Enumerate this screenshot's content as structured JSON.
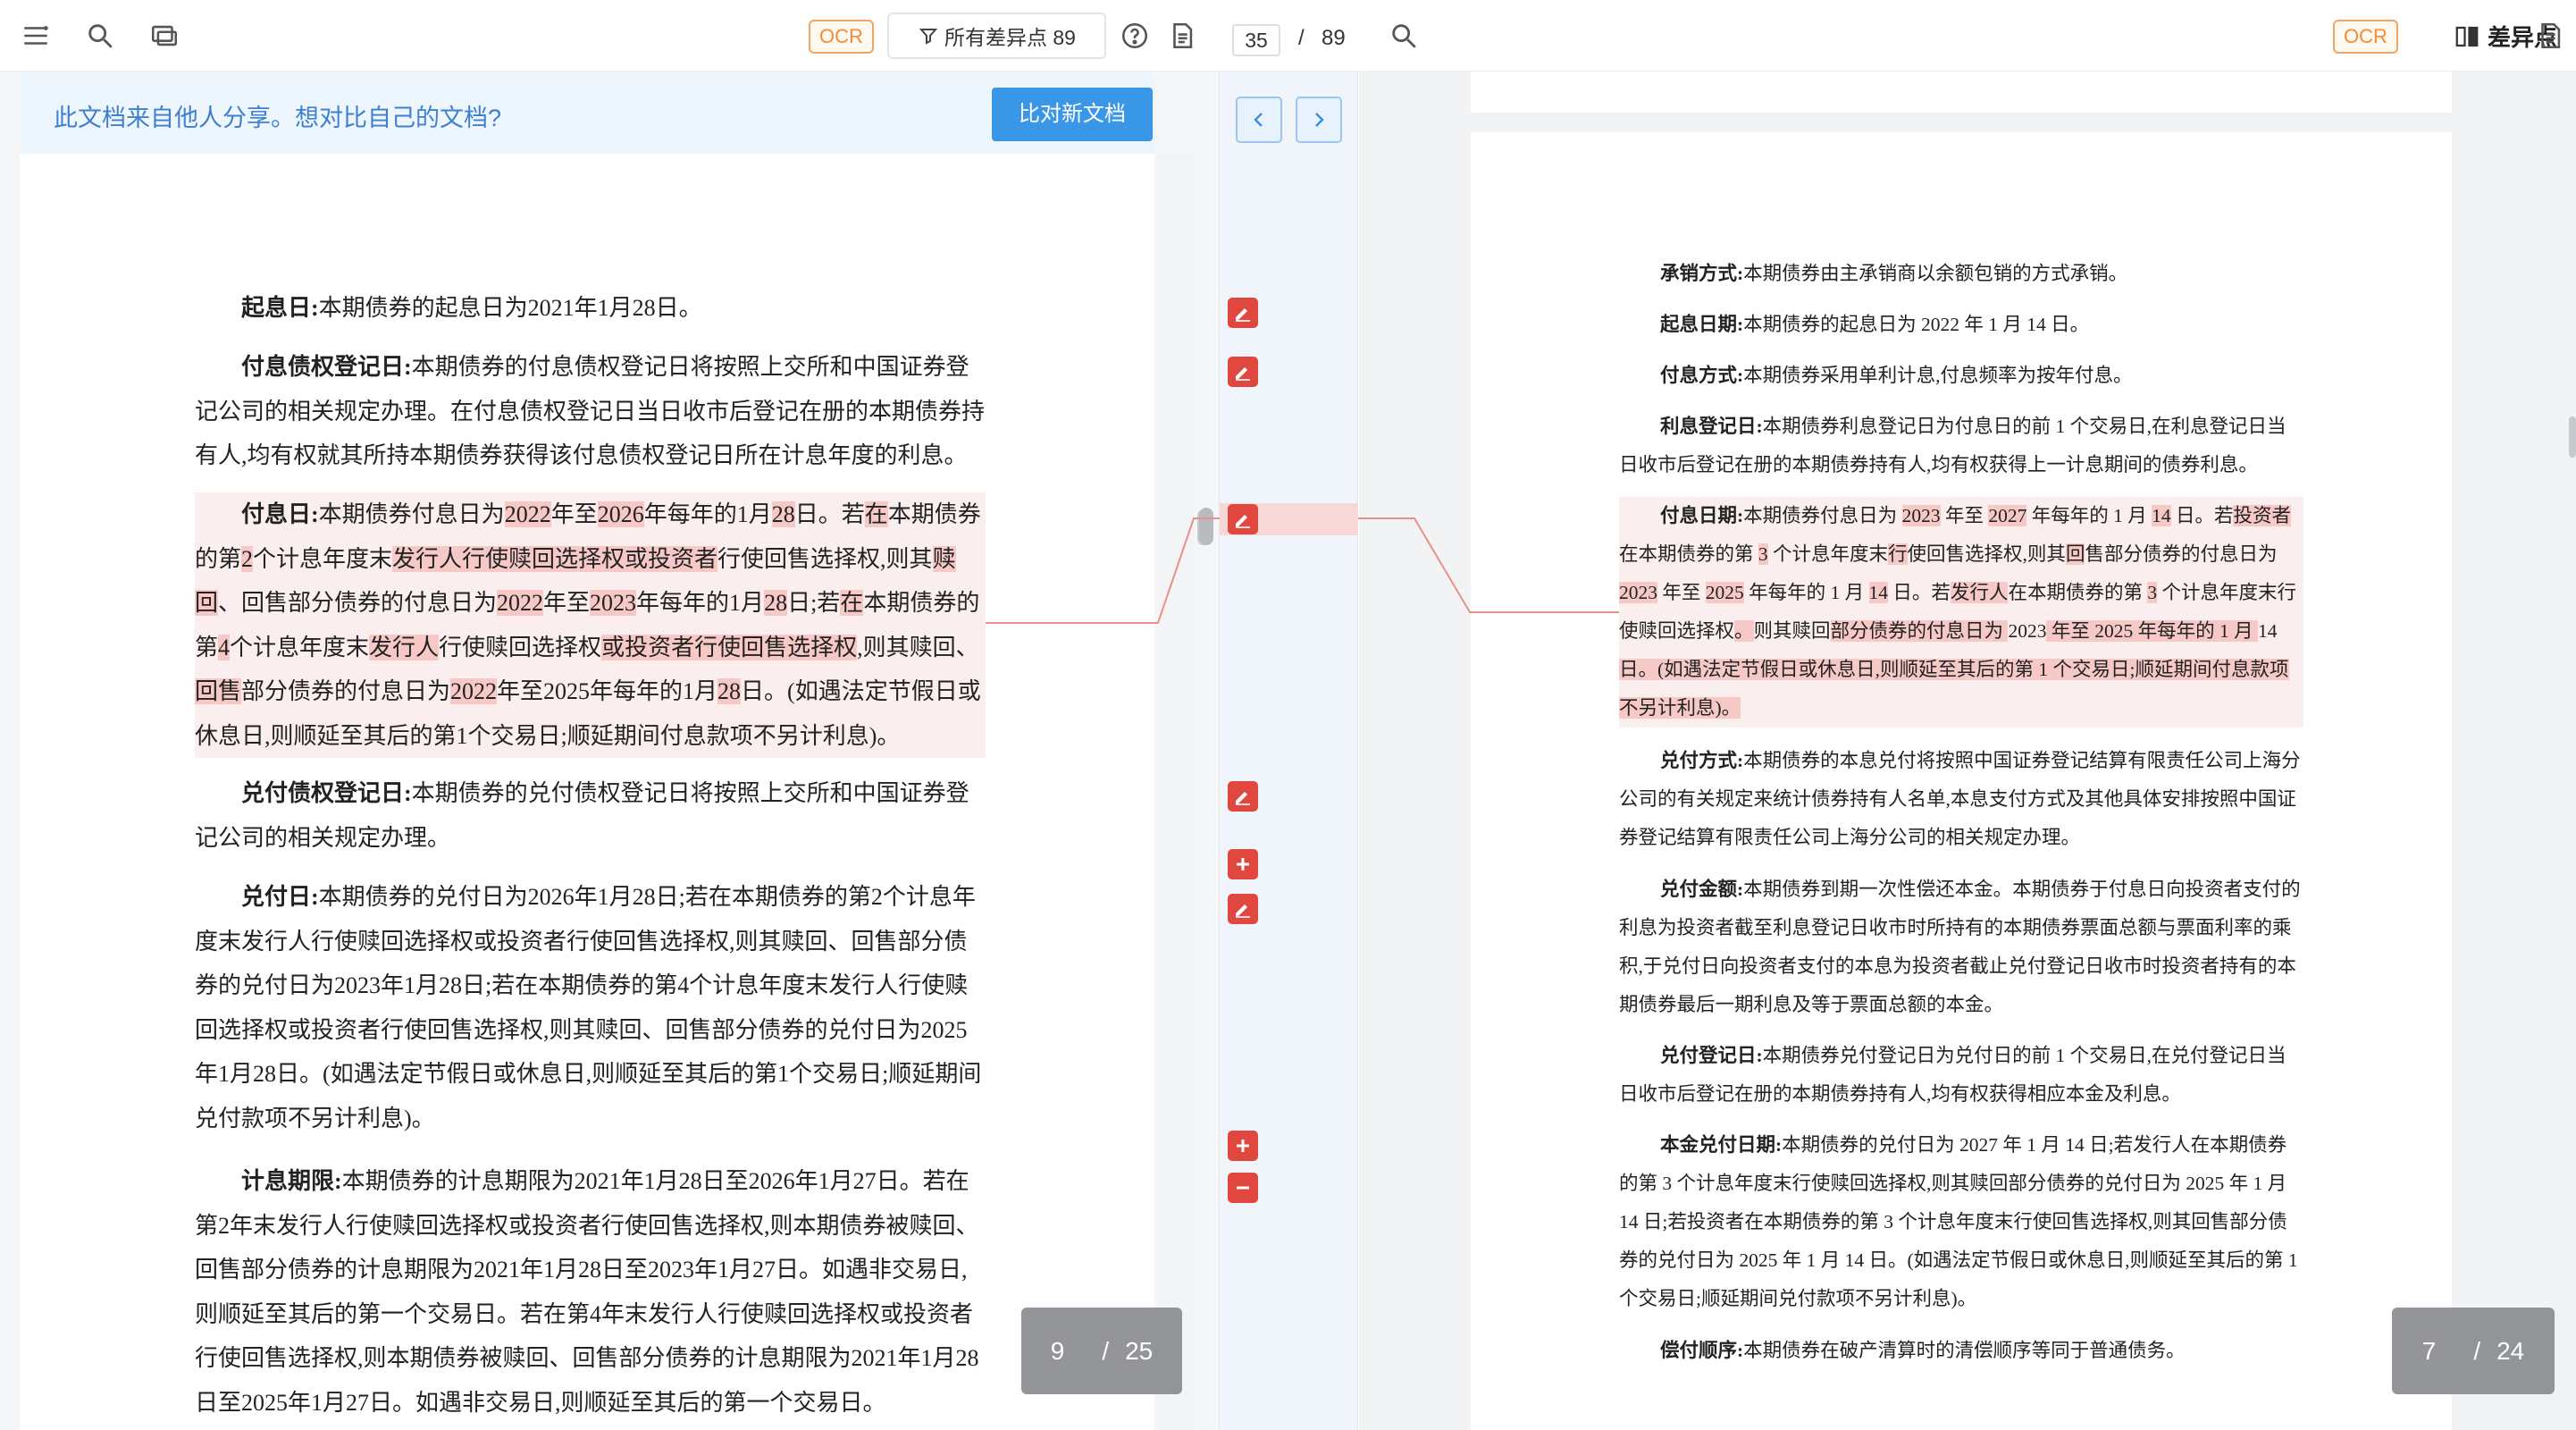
{
  "left": {
    "ocr_label": "OCR",
    "filter_label": "所有差异点 89",
    "banner_text": "此文档来自他人分享。想对比自己的文档?",
    "compare_button": "比对新文档",
    "page_current": "9",
    "page_sep": "/",
    "page_total": "25",
    "paras": [
      {
        "title": "起息日:",
        "body": "本期债券的起息日为2021年1月28日。"
      },
      {
        "title": "付息债权登记日:",
        "body": "本期债券的付息债权登记日将按照上交所和中国证券登记公司的相关规定办理。在付息债权登记日当日收市后登记在册的本期债券持有人,均有权就其所持本期债券获得该付息债权登记日所在计息年度的利息。"
      },
      {
        "title": "付息日:",
        "segs": [
          "本期债券付息日为",
          "2022",
          "年至",
          "2026",
          "年每年的1月",
          "28",
          "日。若",
          "在",
          "本期债券的第",
          "2",
          "个计息年度末",
          "发行人行使赎回选择权或投资者",
          "行使回售选择权,则其",
          "赎回",
          "、回售部分债券的付息日为",
          "2022",
          "年至",
          "2023",
          "年每年的1月",
          "28",
          "日;若",
          "在",
          "本期债券的第",
          "4",
          "个计息年度末",
          "发行人",
          "行使赎回选择权",
          "或投资者行使回售选择权",
          ",则其赎回、",
          "回售",
          "部分债券的付息日为",
          "2022",
          "年至2025年每年的1月",
          "28",
          "日。(如遇法定节假日或休息日,则顺延至其后的第1个交易日;顺延期间付息款项不另计利息)。"
        ]
      },
      {
        "title": "兑付债权登记日:",
        "body": "本期债券的兑付债权登记日将按照上交所和中国证券登记公司的相关规定办理。"
      },
      {
        "title": "兑付日:",
        "body": "本期债券的兑付日为2026年1月28日;若在本期债券的第2个计息年度末发行人行使赎回选择权或投资者行使回售选择权,则其赎回、回售部分债券的兑付日为2023年1月28日;若在本期债券的第4个计息年度末发行人行使赎回选择权或投资者行使回售选择权,则其赎回、回售部分债券的兑付日为2025年1月28日。(如遇法定节假日或休息日,则顺延至其后的第1个交易日;顺延期间兑付款项不另计利息)。"
      },
      {
        "title": "计息期限:",
        "body": "本期债券的计息期限为2021年1月28日至2026年1月27日。若在第2年末发行人行使赎回选择权或投资者行使回售选择权,则本期债券被赎回、回售部分债券的计息期限为2021年1月28日至2023年1月27日。如遇非交易日,则顺延至其后的第一个交易日。若在第4年末发行人行使赎回选择权或投资者行使回售选择权,则本期债券被赎回、回售部分债券的计息期限为2021年1月28日至2025年1月27日。如遇非交易日,则顺延至其后的第一个交易日。"
      }
    ]
  },
  "middle": {
    "page_current": "35",
    "page_sep": "/",
    "page_total": "89"
  },
  "right": {
    "ocr_label": "OCR",
    "diff_label": "差异点",
    "page_current": "7",
    "page_sep": "/",
    "page_total": "24",
    "paras": [
      {
        "title": "承销方式:",
        "body": "本期债券由主承销商以余额包销的方式承销。"
      },
      {
        "title": "起息日期:",
        "body": "本期债券的起息日为 2022 年 1 月 14 日。"
      },
      {
        "title": "付息方式:",
        "body": "本期债券采用单利计息,付息频率为按年付息。"
      },
      {
        "title": "利息登记日:",
        "body": "本期债券利息登记日为付息日的前 1 个交易日,在利息登记日当日收市后登记在册的本期债券持有人,均有权获得上一计息期间的债券利息。"
      },
      {
        "title": "付息日期:",
        "segs": [
          "本期债券付息日为 ",
          "2023",
          " 年至 ",
          "2027",
          " 年每年的 1 月 ",
          "14",
          " 日。若",
          "投资者",
          "在本期债券的第 ",
          "3",
          " 个计息年度末",
          "行",
          "使回售选择权,则其",
          "回",
          "售部分债券的付息日为 ",
          "2023",
          " 年至 ",
          "2025",
          " 年每年的 1 月 ",
          "14",
          " 日。若",
          "发行人",
          "在本期债券的第 ",
          "3",
          " 个计息年度末行使赎回选择权",
          "。",
          "则其赎回",
          "部分债券的付息日为 ",
          "2023",
          " 年至 2025 年每年的 1 月 ",
          "14",
          " 日。(如遇法定节假日或休息日,则顺延至其后的第 1 个交易日;顺延期间付息款项不另计利息)。"
        ]
      },
      {
        "title": "兑付方式:",
        "body": "本期债券的本息兑付将按照中国证券登记结算有限责任公司上海分公司的有关规定来统计债券持有人名单,本息支付方式及其他具体安排按照中国证券登记结算有限责任公司上海分公司的相关规定办理。"
      },
      {
        "title": "兑付金额:",
        "body": "本期债券到期一次性偿还本金。本期债券于付息日向投资者支付的利息为投资者截至利息登记日收市时所持有的本期债券票面总额与票面利率的乘积,于兑付日向投资者支付的本息为投资者截止兑付登记日收市时投资者持有的本期债券最后一期利息及等于票面总额的本金。"
      },
      {
        "title": "兑付登记日:",
        "body": "本期债券兑付登记日为兑付日的前 1 个交易日,在兑付登记日当日收市后登记在册的本期债券持有人,均有权获得相应本金及利息。"
      },
      {
        "title": "本金兑付日期:",
        "body": "本期债券的兑付日为 2027 年 1 月 14 日;若发行人在本期债券的第 3 个计息年度末行使赎回选择权,则其赎回部分债券的兑付日为 2025 年 1 月 14 日;若投资者在本期债券的第 3 个计息年度末行使回售选择权,则其回售部分债券的兑付日为 2025 年 1 月 14 日。(如遇法定节假日或休息日,则顺延至其后的第 1 个交易日;顺延期间兑付款项不另计利息)。"
      },
      {
        "title": "偿付顺序:",
        "body": "本期债券在破产清算时的清偿顺序等同于普通债务。"
      }
    ]
  },
  "colors": {
    "accent": "#3a97e8",
    "diff_red": "#e0473f",
    "highlight_block": "#fbeeee",
    "highlight_strong": "#f6c9c7",
    "ocr_orange": "#ee8d3b"
  },
  "icons": [
    "menu-icon",
    "search-icon",
    "window-icon",
    "filter-icon",
    "help-icon",
    "document-icon",
    "chevron-left-icon",
    "chevron-right-icon",
    "edit-icon",
    "add-icon",
    "remove-icon",
    "split-view-icon"
  ]
}
